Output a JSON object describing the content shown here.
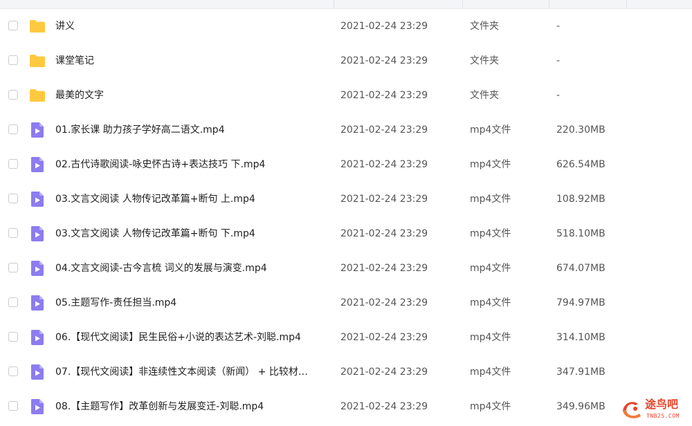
{
  "colors": {
    "folder": "#FFC940",
    "video_file": "#8C7CF0",
    "watermark": "#E8452C"
  },
  "files": [
    {
      "icon": "folder-icon",
      "name": "讲义",
      "date": "2021-02-24 23:29",
      "type": "文件夹",
      "size": "-"
    },
    {
      "icon": "folder-icon",
      "name": "课堂笔记",
      "date": "2021-02-24 23:29",
      "type": "文件夹",
      "size": "-"
    },
    {
      "icon": "folder-icon",
      "name": "最美的文字",
      "date": "2021-02-24 23:29",
      "type": "文件夹",
      "size": "-"
    },
    {
      "icon": "video-file-icon",
      "name": "01.家长课 助力孩子学好高二语文.mp4",
      "date": "2021-02-24 23:29",
      "type": "mp4文件",
      "size": "220.30MB"
    },
    {
      "icon": "video-file-icon",
      "name": "02.古代诗歌阅读-咏史怀古诗+表达技巧 下.mp4",
      "date": "2021-02-24 23:29",
      "type": "mp4文件",
      "size": "626.54MB"
    },
    {
      "icon": "video-file-icon",
      "name": "03.文言文阅读 人物传记改革篇+断句 上.mp4",
      "date": "2021-02-24 23:29",
      "type": "mp4文件",
      "size": "108.92MB"
    },
    {
      "icon": "video-file-icon",
      "name": "03.文言文阅读 人物传记改革篇+断句 下.mp4",
      "date": "2021-02-24 23:29",
      "type": "mp4文件",
      "size": "518.10MB"
    },
    {
      "icon": "video-file-icon",
      "name": "04.文言文阅读-古今言梳 词义的发展与演变.mp4",
      "date": "2021-02-24 23:29",
      "type": "mp4文件",
      "size": "674.07MB"
    },
    {
      "icon": "video-file-icon",
      "name": "05.主题写作-责任担当.mp4",
      "date": "2021-02-24 23:29",
      "type": "mp4文件",
      "size": "794.97MB"
    },
    {
      "icon": "video-file-icon",
      "name": "06.【现代文阅读】民生民俗+小说的表达艺术-刘聪.mp4",
      "date": "2021-02-24 23:29",
      "type": "mp4文件",
      "size": "314.10MB"
    },
    {
      "icon": "video-file-icon",
      "name": "07.【现代文阅读】非连续性文本阅读（新闻） + 比较材…",
      "date": "2021-02-24 23:29",
      "type": "mp4文件",
      "size": "347.91MB"
    },
    {
      "icon": "video-file-icon",
      "name": "08.【主题写作】改革创新与发展变迁-刘聪.mp4",
      "date": "2021-02-24 23:29",
      "type": "mp4文件",
      "size": "349.96MB"
    }
  ],
  "watermark": {
    "title": "途鸟吧",
    "subtitle": "TNB2S.COM"
  }
}
